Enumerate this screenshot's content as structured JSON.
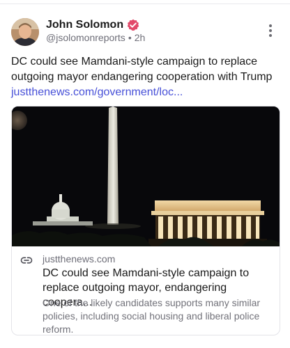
{
  "post": {
    "author": {
      "display_name": "John Solomon",
      "handle": "@jsolomonreports",
      "verified": true,
      "avatar_icon": "avatar-photo"
    },
    "separator": "•",
    "time_ago": "2h",
    "text": "DC could see Mamdani-style campaign to replace outgoing mayor endangering cooperation with Trump",
    "link_text": "justthenews.com/government/loc...",
    "more_icon": "vertical-ellipsis-icon"
  },
  "link_card": {
    "image_icon": "washington-dc-night-skyline-photo",
    "link_icon": "link-icon",
    "domain": "justthenews.com",
    "title": "DC could see Mamdani-style campaign to replace outgoing mayor, endangering coopera...",
    "description": "One of the likely candidates supports many similar policies, including social housing and liberal police reform."
  },
  "colors": {
    "link": "#4750d8",
    "verified_badge": "#e24a6a",
    "muted_text": "#6e6e78"
  }
}
